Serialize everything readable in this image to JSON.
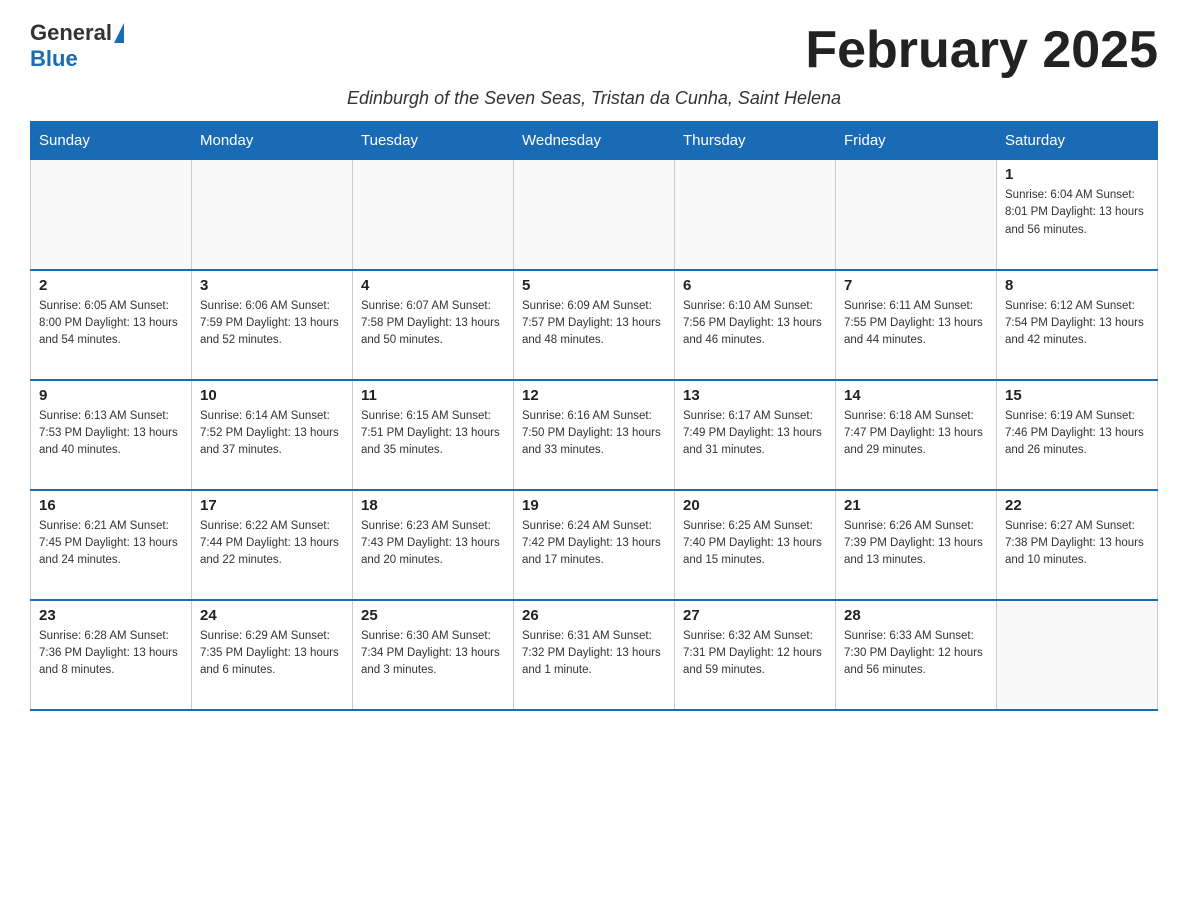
{
  "logo": {
    "general": "General",
    "blue": "Blue"
  },
  "header": {
    "month_title": "February 2025",
    "subtitle": "Edinburgh of the Seven Seas, Tristan da Cunha, Saint Helena"
  },
  "weekdays": [
    "Sunday",
    "Monday",
    "Tuesday",
    "Wednesday",
    "Thursday",
    "Friday",
    "Saturday"
  ],
  "weeks": [
    {
      "days": [
        {
          "num": "",
          "info": ""
        },
        {
          "num": "",
          "info": ""
        },
        {
          "num": "",
          "info": ""
        },
        {
          "num": "",
          "info": ""
        },
        {
          "num": "",
          "info": ""
        },
        {
          "num": "",
          "info": ""
        },
        {
          "num": "1",
          "info": "Sunrise: 6:04 AM\nSunset: 8:01 PM\nDaylight: 13 hours and 56 minutes."
        }
      ]
    },
    {
      "days": [
        {
          "num": "2",
          "info": "Sunrise: 6:05 AM\nSunset: 8:00 PM\nDaylight: 13 hours and 54 minutes."
        },
        {
          "num": "3",
          "info": "Sunrise: 6:06 AM\nSunset: 7:59 PM\nDaylight: 13 hours and 52 minutes."
        },
        {
          "num": "4",
          "info": "Sunrise: 6:07 AM\nSunset: 7:58 PM\nDaylight: 13 hours and 50 minutes."
        },
        {
          "num": "5",
          "info": "Sunrise: 6:09 AM\nSunset: 7:57 PM\nDaylight: 13 hours and 48 minutes."
        },
        {
          "num": "6",
          "info": "Sunrise: 6:10 AM\nSunset: 7:56 PM\nDaylight: 13 hours and 46 minutes."
        },
        {
          "num": "7",
          "info": "Sunrise: 6:11 AM\nSunset: 7:55 PM\nDaylight: 13 hours and 44 minutes."
        },
        {
          "num": "8",
          "info": "Sunrise: 6:12 AM\nSunset: 7:54 PM\nDaylight: 13 hours and 42 minutes."
        }
      ]
    },
    {
      "days": [
        {
          "num": "9",
          "info": "Sunrise: 6:13 AM\nSunset: 7:53 PM\nDaylight: 13 hours and 40 minutes."
        },
        {
          "num": "10",
          "info": "Sunrise: 6:14 AM\nSunset: 7:52 PM\nDaylight: 13 hours and 37 minutes."
        },
        {
          "num": "11",
          "info": "Sunrise: 6:15 AM\nSunset: 7:51 PM\nDaylight: 13 hours and 35 minutes."
        },
        {
          "num": "12",
          "info": "Sunrise: 6:16 AM\nSunset: 7:50 PM\nDaylight: 13 hours and 33 minutes."
        },
        {
          "num": "13",
          "info": "Sunrise: 6:17 AM\nSunset: 7:49 PM\nDaylight: 13 hours and 31 minutes."
        },
        {
          "num": "14",
          "info": "Sunrise: 6:18 AM\nSunset: 7:47 PM\nDaylight: 13 hours and 29 minutes."
        },
        {
          "num": "15",
          "info": "Sunrise: 6:19 AM\nSunset: 7:46 PM\nDaylight: 13 hours and 26 minutes."
        }
      ]
    },
    {
      "days": [
        {
          "num": "16",
          "info": "Sunrise: 6:21 AM\nSunset: 7:45 PM\nDaylight: 13 hours and 24 minutes."
        },
        {
          "num": "17",
          "info": "Sunrise: 6:22 AM\nSunset: 7:44 PM\nDaylight: 13 hours and 22 minutes."
        },
        {
          "num": "18",
          "info": "Sunrise: 6:23 AM\nSunset: 7:43 PM\nDaylight: 13 hours and 20 minutes."
        },
        {
          "num": "19",
          "info": "Sunrise: 6:24 AM\nSunset: 7:42 PM\nDaylight: 13 hours and 17 minutes."
        },
        {
          "num": "20",
          "info": "Sunrise: 6:25 AM\nSunset: 7:40 PM\nDaylight: 13 hours and 15 minutes."
        },
        {
          "num": "21",
          "info": "Sunrise: 6:26 AM\nSunset: 7:39 PM\nDaylight: 13 hours and 13 minutes."
        },
        {
          "num": "22",
          "info": "Sunrise: 6:27 AM\nSunset: 7:38 PM\nDaylight: 13 hours and 10 minutes."
        }
      ]
    },
    {
      "days": [
        {
          "num": "23",
          "info": "Sunrise: 6:28 AM\nSunset: 7:36 PM\nDaylight: 13 hours and 8 minutes."
        },
        {
          "num": "24",
          "info": "Sunrise: 6:29 AM\nSunset: 7:35 PM\nDaylight: 13 hours and 6 minutes."
        },
        {
          "num": "25",
          "info": "Sunrise: 6:30 AM\nSunset: 7:34 PM\nDaylight: 13 hours and 3 minutes."
        },
        {
          "num": "26",
          "info": "Sunrise: 6:31 AM\nSunset: 7:32 PM\nDaylight: 13 hours and 1 minute."
        },
        {
          "num": "27",
          "info": "Sunrise: 6:32 AM\nSunset: 7:31 PM\nDaylight: 12 hours and 59 minutes."
        },
        {
          "num": "28",
          "info": "Sunrise: 6:33 AM\nSunset: 7:30 PM\nDaylight: 12 hours and 56 minutes."
        },
        {
          "num": "",
          "info": ""
        }
      ]
    }
  ]
}
